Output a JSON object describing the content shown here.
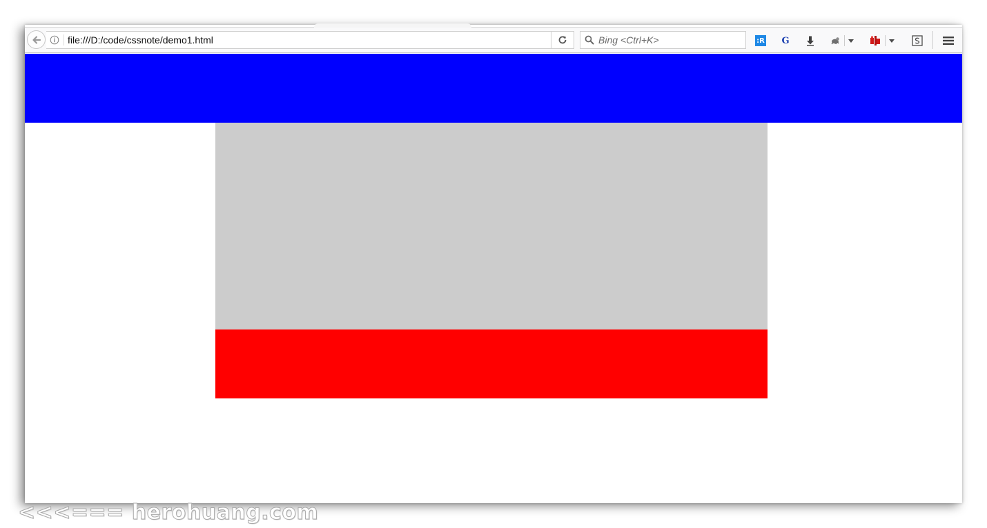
{
  "browser": {
    "url": "file:///D:/code/cssnote/demo1.html",
    "search_placeholder": "Bing <Ctrl+K>",
    "toolbar_icons": [
      "back-arrow-icon",
      "info-icon",
      "reload-icon",
      "search-icon",
      "reader-extension-icon",
      "google-translate-icon",
      "download-icon",
      "extension-icon",
      "dropdown-arrow-icon",
      "red-extension-icon",
      "dropdown-arrow-icon",
      "screenshot-icon",
      "hamburger-menu-icon"
    ],
    "extension_labels": {
      "reader": ":R",
      "translate": "G"
    }
  },
  "page": {
    "colors": {
      "header": "#0000ff",
      "content": "#cccccc",
      "footer": "#ff0000"
    }
  },
  "watermark": {
    "text": "<<<=== herohuang.com"
  }
}
